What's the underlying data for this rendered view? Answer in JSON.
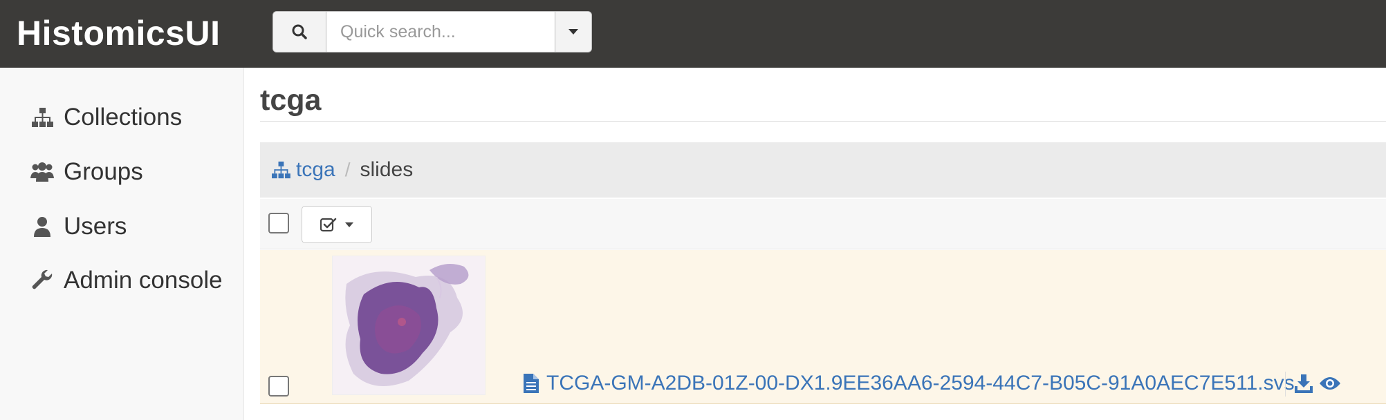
{
  "header": {
    "brand": "HistomicsUI",
    "search": {
      "placeholder": "Quick search...",
      "value": ""
    }
  },
  "sidebar": {
    "items": [
      {
        "label": "Collections",
        "icon": "sitemap-icon"
      },
      {
        "label": "Groups",
        "icon": "users-icon"
      },
      {
        "label": "Users",
        "icon": "user-icon"
      },
      {
        "label": "Admin console",
        "icon": "wrench-icon"
      }
    ]
  },
  "main": {
    "title": "tcga",
    "breadcrumb": {
      "root": "tcga",
      "separator": "/",
      "current": "slides"
    },
    "items": [
      {
        "name": "TCGA-GM-A2DB-01Z-00-DX1.9EE36AA6-2594-44C7-B05C-91A0AEC7E511.svs"
      }
    ]
  },
  "colors": {
    "header_bg": "#3c3b39",
    "link": "#3a74b8",
    "row_highlight": "#fdf6e8"
  }
}
